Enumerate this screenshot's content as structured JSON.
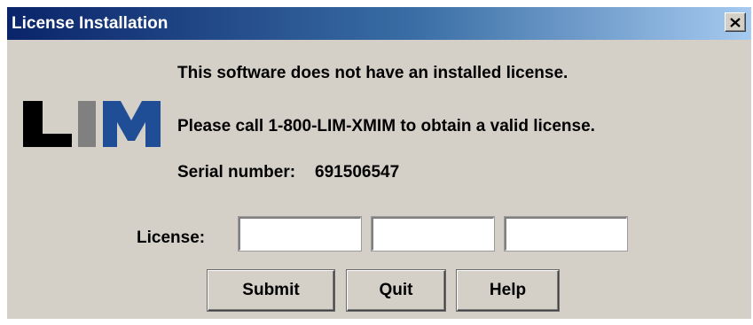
{
  "window": {
    "title": "License Installation",
    "close_glyph": "×"
  },
  "logo": {
    "text": "LIM",
    "colors": {
      "L": "#000000",
      "I": "#808080",
      "M": "#1f4e96"
    }
  },
  "messages": {
    "line1": "This software does not have an installed license.",
    "line2": "Please call 1-800-LIM-XMIM to obtain a valid license.",
    "serial_label": "Serial number:",
    "serial_value": "691506547"
  },
  "license": {
    "label": "License:",
    "fields": [
      {
        "value": ""
      },
      {
        "value": ""
      },
      {
        "value": ""
      }
    ]
  },
  "buttons": {
    "submit": "Submit",
    "quit": "Quit",
    "help": "Help"
  },
  "colors": {
    "titlebar_start": "#0a246a",
    "titlebar_end": "#a6caf0",
    "dialog_background": "#d4d0c8"
  }
}
